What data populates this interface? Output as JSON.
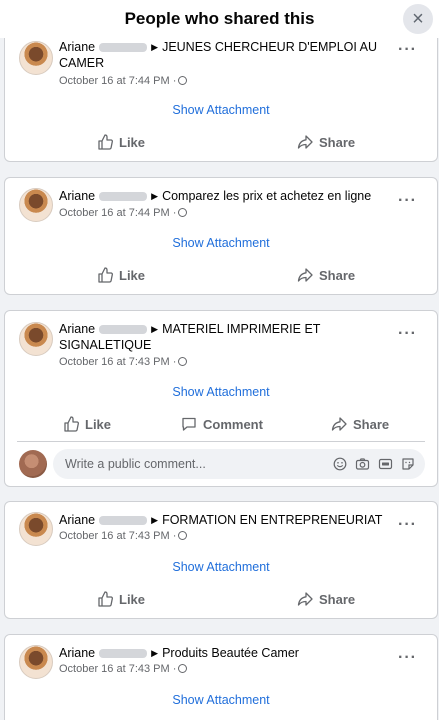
{
  "header": {
    "title": "People who shared this",
    "close_glyph": "×"
  },
  "attachment_link": "Show Attachment",
  "actions": {
    "like": "Like",
    "comment": "Comment",
    "share": "Share"
  },
  "comment": {
    "placeholder": "Write a public comment..."
  },
  "more_glyph": "···",
  "posts": [
    {
      "author": "Ariane",
      "group_line1": "JEUNES CHERCHEUR D'EMPLOI AU",
      "group_line2": "CAMER",
      "time": "October 16 at 7:44 PM ·"
    },
    {
      "author": "Ariane",
      "group_line1": "Comparez les prix et achetez en ligne",
      "group_line2": "",
      "time": "October 16 at 7:44 PM ·"
    },
    {
      "author": "Ariane",
      "group_line1": "MATERIEL IMPRIMERIE ET",
      "group_line2": "SIGNALETIQUE",
      "time": "October 16 at 7:43 PM ·"
    },
    {
      "author": "Ariane",
      "group_line1": "FORMATION EN ENTREPRENEURIAT",
      "group_line2": "",
      "time": "October 16 at 7:43 PM ·"
    },
    {
      "author": "Ariane",
      "group_line1": "Produits Beautée Camer",
      "group_line2": "",
      "time": "October 16 at 7:43 PM ·"
    }
  ]
}
